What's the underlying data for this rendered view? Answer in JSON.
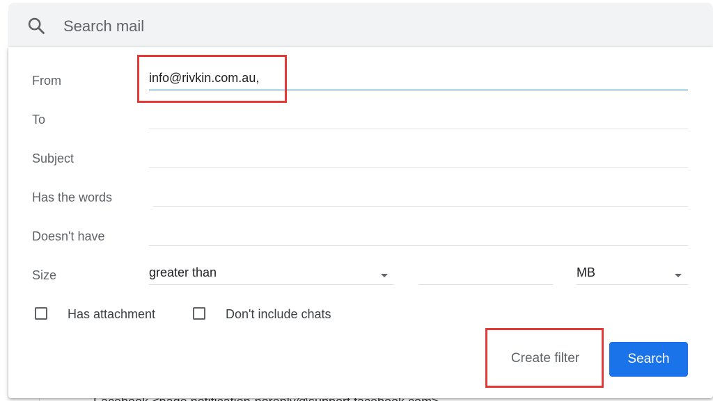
{
  "search": {
    "placeholder": "Search mail"
  },
  "filter_form": {
    "from": {
      "label": "From",
      "value": "info@rivkin.com.au,"
    },
    "to": {
      "label": "To",
      "value": ""
    },
    "subject": {
      "label": "Subject",
      "value": ""
    },
    "has_words": {
      "label": "Has the words",
      "value": ""
    },
    "doesnt_have": {
      "label": "Doesn't have",
      "value": ""
    },
    "size": {
      "label": "Size",
      "comparator": "greater than",
      "amount": "",
      "unit": "MB"
    },
    "has_attachment": {
      "label": "Has attachment",
      "checked": false
    },
    "dont_include_chats": {
      "label": "Don't include chats",
      "checked": false
    },
    "create_filter_label": "Create filter",
    "search_label": "Search"
  },
  "background_peek_text": "Facebook <page notification-noreply@support.facebook.com>",
  "colors": {
    "accent": "#1a73e8",
    "highlight": "#e53935",
    "search_bar_bg": "#f1f3f4"
  },
  "icons": {
    "search": "search-icon"
  }
}
